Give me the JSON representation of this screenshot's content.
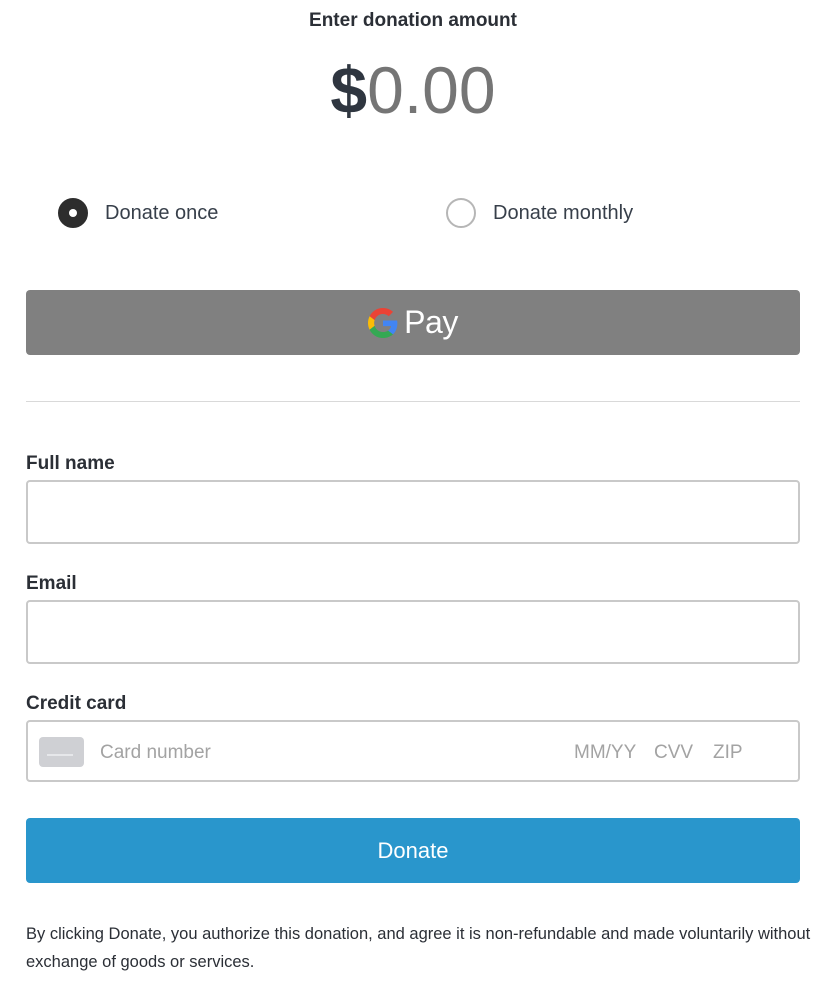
{
  "header": {
    "title": "Enter donation amount",
    "currency_symbol": "$",
    "amount_value": "0.00"
  },
  "frequency": {
    "options": [
      {
        "label": "Donate once",
        "selected": true
      },
      {
        "label": "Donate monthly",
        "selected": false
      }
    ]
  },
  "gpay": {
    "label": "Pay",
    "background": "#808080"
  },
  "form": {
    "full_name_label": "Full name",
    "full_name_value": "",
    "email_label": "Email",
    "email_value": "",
    "credit_card_label": "Credit card",
    "card_number_placeholder": "Card number",
    "expiry_placeholder": "MM/YY",
    "cvv_placeholder": "CVV",
    "zip_placeholder": "ZIP"
  },
  "donate_button": {
    "label": "Donate",
    "color": "#2996cc"
  },
  "disclaimer": "By clicking Donate, you authorize this donation, and agree it is non-refundable and made voluntarily without exchange of goods or services."
}
